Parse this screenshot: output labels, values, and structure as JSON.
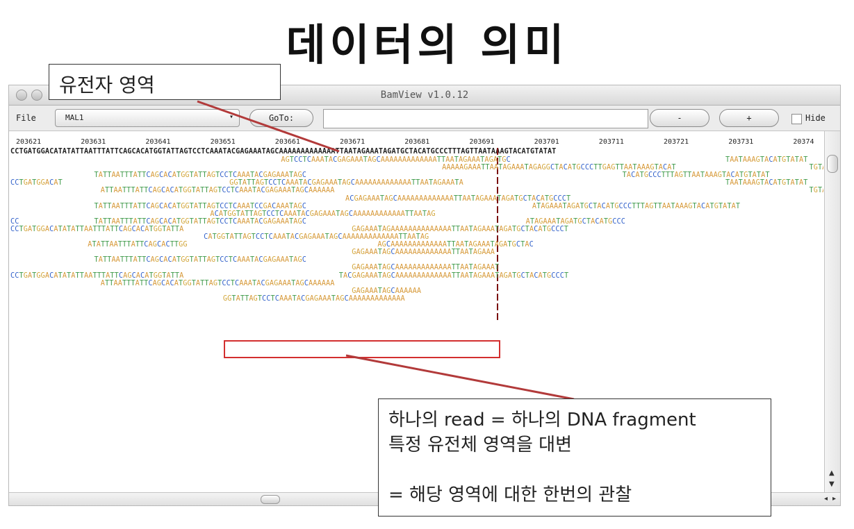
{
  "slide": {
    "title": "데이터의 의미"
  },
  "window": {
    "title": "BamView v1.0.12"
  },
  "toolbar": {
    "file_label": "File",
    "file_value": "MAL1",
    "goto_label": "GoTo:",
    "goto_value": "",
    "zoom_out_label": "-",
    "zoom_in_label": "+",
    "hide_label": "Hide",
    "hide_checked": false
  },
  "viewer": {
    "coordinates": [
      "203621",
      "203631",
      "203641",
      "203651",
      "203661",
      "203671",
      "203681",
      "203691",
      "203701",
      "203711",
      "203721",
      "203731",
      "20374"
    ],
    "reference": "CCTGATGGACATATATTAATTTATTCAGCACATGGTATTAGTCCTCAAATACGAGAAATAGCAAAAAAAAAAAAATTAATAGAAATAGATGCTACATGCCCTTTAGTTAATAAAGTACATGTATAT",
    "reads": [
      {
        "offset": 42,
        "seq": "AGTCCTCAAATACGAGAAATAGCAAAAAAAAAAAAATTAATAGAAATAGATGC"
      },
      {
        "offset": 111,
        "seq": "TAATAAAGTACATGTATAT"
      },
      {
        "offset": 67,
        "seq": "AAAAAGAAATTAATAGAAATAGAGGCTACATGCCCTTGAGTTAATAAAGTACAT"
      },
      {
        "offset": 13,
        "seq": "TATTAATTTATTCAGCACATGGTATTAGTCCTCAAATACGAGAAATAGC"
      },
      {
        "offset": 95,
        "seq": "TACATGCCCTTTAGTTAATAAAGTACATGTATAT"
      },
      {
        "offset": 0,
        "seq": "CCTGATGGACAT"
      },
      {
        "offset": 34,
        "seq": "GGTATTAGTCCTCAAATACGAGAAATAGCAAAAAAAAAAAAATTAATAGAAATA"
      },
      {
        "offset": 111,
        "seq": "TAATAAAGTACATGTATAT"
      },
      {
        "offset": 14,
        "seq": "ATTAATTTATTCAGCACATGGTATTAGTCCTCAAATACGAGAAATAGCAAAAAA"
      },
      {
        "offset": 124,
        "seq": "TGTATAT"
      },
      {
        "offset": 52,
        "seq": "ACGAGAAATAGCAAAAAAAAAAAAATTAATAGAAATAGATGCTACATGCCCT"
      },
      {
        "offset": 124,
        "seq": "TGTATAT"
      },
      {
        "offset": 13,
        "seq": "TATTAATTTATTCAGCACATGGTATTAGTCCTCAAATCCGACAAATAGC"
      },
      {
        "offset": 81,
        "seq": "ATAGAAATAGATGCTACATGCCCTTTAGTTAATAAAGTACATGTATAT"
      },
      {
        "offset": 31,
        "seq": "ACATGGTATTAGTCCTCAAATACGAGAAATAGCAAAAAAAAAAAATTAATAG"
      },
      {
        "offset": 0,
        "seq": "CC"
      },
      {
        "offset": 13,
        "seq": "TATTAATTTATTCAGCACATGGTATTAGTCCTCAAATACGAGAAATAGC"
      },
      {
        "offset": 80,
        "seq": "ATAGAAATAGATGCTACATGCCC"
      },
      {
        "offset": 0,
        "seq": "CCTGATGGACATATATTAATTTATTCAGCACATGGTATTA"
      },
      {
        "offset": 53,
        "seq": "GAGAAATAGAAAAAAAAAAAAAATTAATAGAAATAGATGCTACATGCCCT"
      },
      {
        "offset": 30,
        "seq": "CATGGTATTAGTCCTCAAATACGAGAAATAGCAAAAAAAAAAAAATTAATAG"
      },
      {
        "offset": 12,
        "seq": "ATATTAATTTATTCAGCACTTGG"
      },
      {
        "offset": 57,
        "seq": "AGCAAAAAAAAAAAAATTAATAGAAATAGATGCTAC"
      },
      {
        "offset": 53,
        "seq": "GAGAAATAGCAAAAAAAAAAAAATTAATAGAAA"
      },
      {
        "offset": 13,
        "seq": "TATTAATTTATTCAGCACATGGTATTAGTCCTCAAATACGAGAAATAGC"
      },
      {
        "offset": 53,
        "seq": "GAGAAATAGCAAAAAAAAAAAAATTAATAGAAAT"
      },
      {
        "offset": 0,
        "seq": "CCTGATGGACATATATTAATTTATTCAGCACATGGTATTA"
      },
      {
        "offset": 51,
        "seq": "TACGAGAAATAGCAAAAAAAAAAAAATTAATAGAAATAGATGCTACATGCCCT"
      },
      {
        "offset": 14,
        "seq": "ATTAATTTATTCAGCACATGGTATTAGTCCTCAAATACGAGAAATAGCAAAAAA"
      },
      {
        "offset": 53,
        "seq": "GAGAAATAGCAAAAAA"
      },
      {
        "offset": 33,
        "seq": "GGTATTAGTCCTCAAATACGAGAAATAGCAAAAAAAAAAAAA"
      }
    ]
  },
  "annotations": {
    "top_label": "유전자 영역",
    "bottom_lines": [
      "하나의 read = 하나의 DNA fragment",
      "특정 유전체 영역을 대변",
      "",
      "= 해당 영역에 대한 한번의 관찰"
    ],
    "arrow_color": "#b23a3a",
    "highlight_color": "#d32f2f"
  },
  "colors": {
    "A": "#d79a3b",
    "T": "#3f9a4a",
    "G": "#d2a63a",
    "C": "#2f5fc9"
  }
}
